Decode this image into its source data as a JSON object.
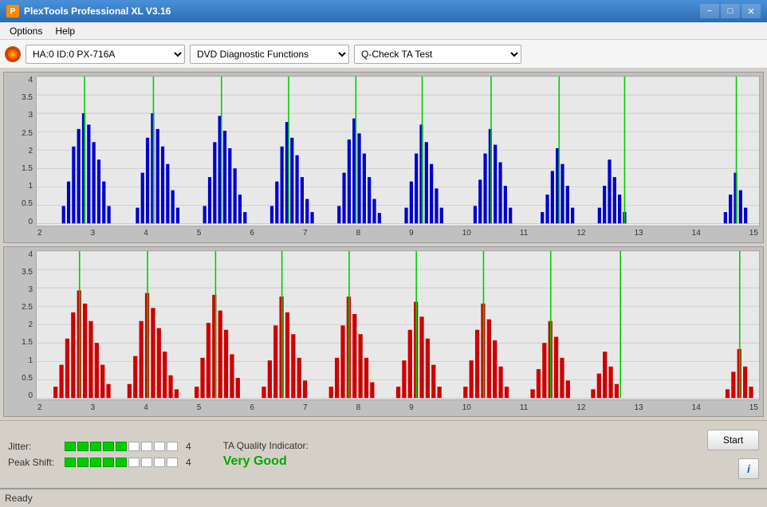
{
  "titleBar": {
    "title": "PlexTools Professional XL V3.16",
    "icon": "P",
    "minimize": "−",
    "maximize": "□",
    "close": "✕"
  },
  "menuBar": {
    "items": [
      "Options",
      "Help"
    ]
  },
  "toolbar": {
    "drive": "HA:0 ID:0  PX-716A",
    "function": "DVD Diagnostic Functions",
    "test": "Q-Check TA Test"
  },
  "charts": {
    "topChart": {
      "color": "#0000cc",
      "yLabels": [
        "4",
        "3.5",
        "3",
        "2.5",
        "2",
        "1.5",
        "1",
        "0.5",
        "0"
      ],
      "xLabels": [
        "2",
        "3",
        "4",
        "5",
        "6",
        "7",
        "8",
        "9",
        "10",
        "11",
        "12",
        "13",
        "14",
        "15"
      ]
    },
    "bottomChart": {
      "color": "#cc0000",
      "yLabels": [
        "4",
        "3.5",
        "3",
        "2.5",
        "2",
        "1.5",
        "1",
        "0.5",
        "0"
      ],
      "xLabels": [
        "2",
        "3",
        "4",
        "5",
        "6",
        "7",
        "8",
        "9",
        "10",
        "11",
        "12",
        "13",
        "14",
        "15"
      ]
    }
  },
  "metrics": {
    "jitter": {
      "label": "Jitter:",
      "filledSegments": 5,
      "totalSegments": 9,
      "value": "4"
    },
    "peakShift": {
      "label": "Peak Shift:",
      "filledSegments": 5,
      "totalSegments": 9,
      "value": "4"
    },
    "taQuality": {
      "label": "TA Quality Indicator:",
      "value": "Very Good"
    }
  },
  "buttons": {
    "start": "Start",
    "info": "i"
  },
  "statusBar": {
    "text": "Ready"
  }
}
